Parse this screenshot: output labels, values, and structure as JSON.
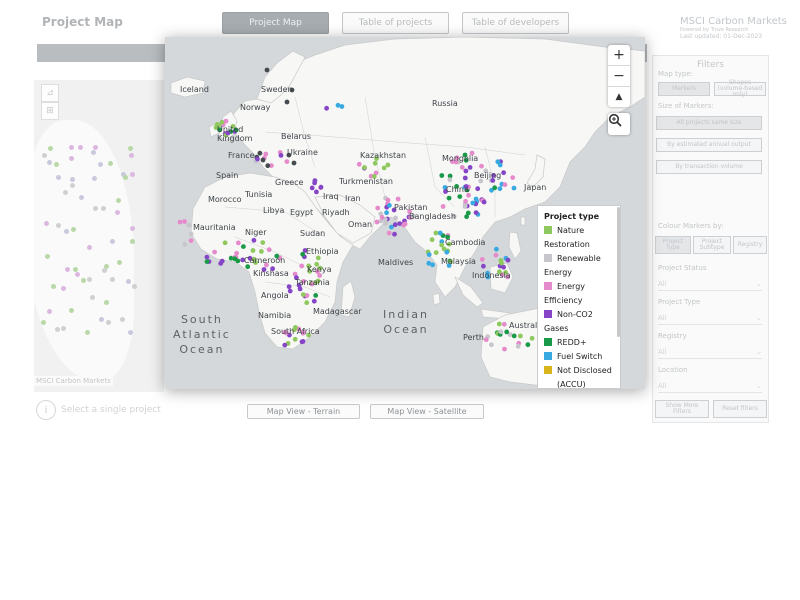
{
  "page": {
    "title": "Project Map",
    "tabs": [
      {
        "label": "Project Map",
        "active": true
      },
      {
        "label": "Table of projects",
        "active": false
      },
      {
        "label": "Table of developers",
        "active": false
      }
    ],
    "brand": {
      "name": "MSCI Carbon Markets",
      "powered": "Powered by Trove Research",
      "updated": "Last updated: 01-Dec-2023"
    }
  },
  "left_map": {
    "credit": "MSCI Carbon Markets",
    "single_project": "Select a single project"
  },
  "view_buttons": {
    "terrain": "Map View - Terrain",
    "satellite": "Map View - Satellite"
  },
  "filters": {
    "title": "Filters",
    "map_type_label": "Map type:",
    "map_type_options": [
      "Markers",
      "Shapes (volume-based only)"
    ],
    "size_label": "Size of Markers:",
    "size_options": [
      "All projects same size",
      "By estimated annual output",
      "By transaction volume"
    ],
    "colour_label": "Colour Markers by:",
    "colour_options": [
      "Project Type",
      "Project Subtype",
      "Registry"
    ],
    "selects": [
      {
        "label": "Project Status",
        "value": "All"
      },
      {
        "label": "Project Type",
        "value": "All"
      },
      {
        "label": "Registry",
        "value": "All"
      },
      {
        "label": "Location",
        "value": "All"
      }
    ],
    "show_more": "Show More Filters",
    "reset": "Reset filters"
  },
  "map": {
    "zoom_in": "+",
    "zoom_out": "−",
    "compass": "▲",
    "labels": {
      "iceland": "Iceland",
      "sweden": "Sweden",
      "norway": "Norway",
      "uk1": "United",
      "uk2": "Kingdom",
      "russia": "Russia",
      "belarus": "Belarus",
      "ukraine": "Ukraine",
      "france": "France",
      "spain": "Spain",
      "greece": "Greece",
      "kazakhstan": "Kazakhstan",
      "mongolia": "Mongolia",
      "beijing": "Beijing",
      "turkmenistan": "Turkmenistan",
      "tunisia": "Tunisia",
      "morocco": "Morocco",
      "libya": "Libya",
      "egypt": "Egypt",
      "iraq": "Iraq",
      "iran": "Iran",
      "pakistan": "Pakistan",
      "china": "China",
      "japan": "Japan",
      "riyadh": "Riyadh",
      "oman": "Oman",
      "bangladesh": "Bangladesh",
      "mauritania": "Mauritania",
      "niger": "Niger",
      "sudan": "Sudan",
      "ethiopia": "Ethiopia",
      "cambodia": "Cambodia",
      "cameroon": "Cameroon",
      "maldives": "Maldives",
      "malaysia": "Malaysia",
      "kinshasa": "Kinshasa",
      "kenya": "Kenya",
      "tanzania": "Tanzania",
      "indonesia": "Indonesia",
      "angola": "Angola",
      "namibia": "Namibia",
      "madagascar": "Madagascar",
      "australia": "Australia",
      "southafrica": "South Africa",
      "perth": "Perth"
    },
    "oceans": {
      "south_atlantic": "South\nAtlantic\nOcean",
      "indian": "Indian\nOcean"
    }
  },
  "legend": {
    "title": "Project type",
    "items": [
      {
        "label": "Nature Restoration",
        "color": "#8fc85e"
      },
      {
        "label": "Renewable Energy",
        "color": "#c6c6cc"
      },
      {
        "label": "Energy Efficiency",
        "color": "#e58acb"
      },
      {
        "label": "Non-CO2 Gases",
        "color": "#8545c6"
      },
      {
        "label": "REDD+",
        "color": "#1a9a48"
      },
      {
        "label": "Fuel Switch",
        "color": "#39a9e1"
      },
      {
        "label": "Not Disclosed",
        "color": "#d8b51a"
      },
      {
        "label": "(ACCU)",
        "color": "#ffffff"
      }
    ]
  },
  "colors": {
    "nature": "#8fc85e",
    "renewable": "#c6c6cc",
    "efficiency": "#e58acb",
    "nonco2": "#8545c6",
    "redd": "#1a9a48",
    "fuelswitch": "#39a9e1",
    "notdisclosed": "#d8b51a",
    "other": "#444a4e"
  }
}
